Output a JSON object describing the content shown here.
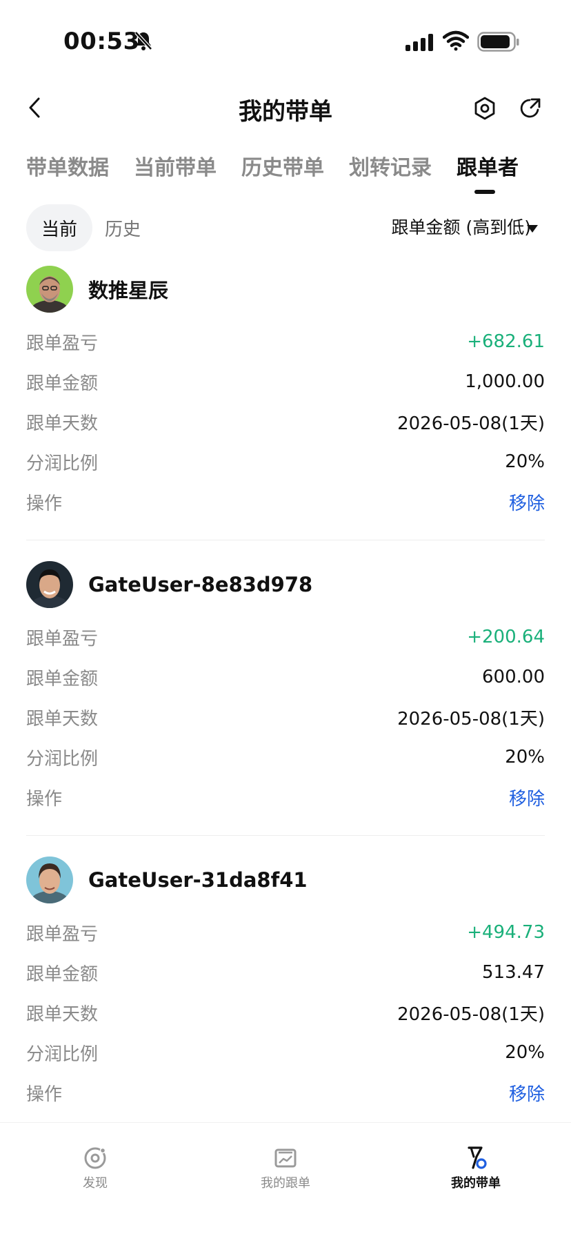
{
  "status_bar": {
    "time": "00:53"
  },
  "header": {
    "title": "我的带单"
  },
  "tabs": [
    {
      "label": "带单数据"
    },
    {
      "label": "当前带单"
    },
    {
      "label": "历史带单"
    },
    {
      "label": "划转记录"
    },
    {
      "label": "跟单者",
      "active": true
    }
  ],
  "filter": {
    "current": "当前",
    "history": "历史",
    "sort": "跟单金额 (高到低)"
  },
  "followers": [
    {
      "name": "数推星辰",
      "rows": [
        {
          "label": "跟单盈亏",
          "value": "+682.61"
        },
        {
          "label": "跟单金额",
          "value": "1,000.00"
        },
        {
          "label": "跟单天数",
          "value": "2026-05-08(1天)"
        },
        {
          "label": "分润比例",
          "value": "20%"
        },
        {
          "label": "操作",
          "value": "移除"
        }
      ]
    },
    {
      "name": "GateUser-8e83d978",
      "rows": [
        {
          "label": "跟单盈亏",
          "value": "+200.64"
        },
        {
          "label": "跟单金额",
          "value": "600.00"
        },
        {
          "label": "跟单天数",
          "value": "2026-05-08(1天)"
        },
        {
          "label": "分润比例",
          "value": "20%"
        },
        {
          "label": "操作",
          "value": "移除"
        }
      ]
    },
    {
      "name": "GateUser-31da8f41",
      "rows": [
        {
          "label": "跟单盈亏",
          "value": "+494.73"
        },
        {
          "label": "跟单金额",
          "value": "513.47"
        },
        {
          "label": "跟单天数",
          "value": "2026-05-08(1天)"
        },
        {
          "label": "分润比例",
          "value": "20%"
        },
        {
          "label": "操作",
          "value": "移除"
        }
      ]
    }
  ],
  "bottom_nav": [
    {
      "label": "发现",
      "icon": "discover-icon"
    },
    {
      "label": "我的跟单",
      "icon": "chart-icon"
    },
    {
      "label": "我的带单",
      "icon": "lead-icon",
      "active": true
    }
  ],
  "colors": {
    "profit": "#1ab07a",
    "action": "#1f5fe0",
    "muted": "#8a8a8a"
  }
}
